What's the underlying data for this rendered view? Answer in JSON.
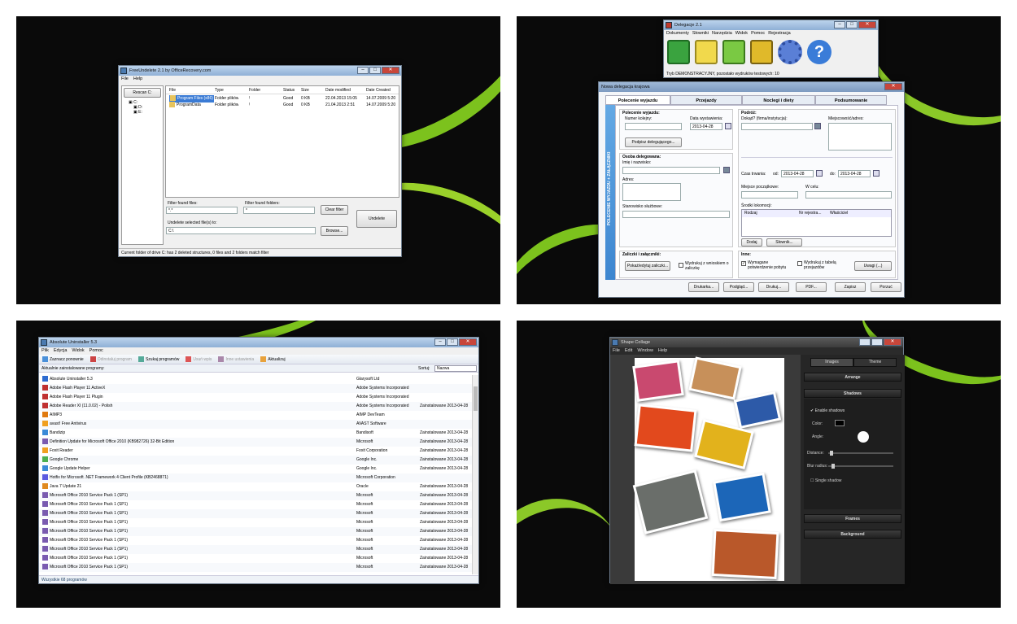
{
  "freeundelete": {
    "title": "FreeUndelete 2.1 by OfficeRecovery.com",
    "menu": [
      "File",
      "Help"
    ],
    "rescan_label": "Rescan C:",
    "drives": [
      "C:",
      "D:",
      "E:"
    ],
    "columns": [
      "File",
      "Type",
      "Folder",
      "Status",
      "Size",
      "Date modified",
      "Date Created"
    ],
    "rows": [
      [
        "Program Files (x86)",
        "Folder plików",
        "\\",
        "Good",
        "0 KB",
        "22.04.2013 15:05",
        "14.07.2009 5:20"
      ],
      [
        "ProgramData",
        "Folder plików",
        "\\",
        "Good",
        "0 KB",
        "21.04.2013 2:51",
        "14.07.2009 5:20"
      ]
    ],
    "filter_files_label": "Filter found files:",
    "filter_files_value": "*.*",
    "filter_folders_label": "Filter found folders:",
    "filter_folders_value": "*",
    "clear_filter_label": "Clear filter",
    "undelete_to_label": "Undelete selected file(s) to:",
    "undelete_to_value": "C:\\",
    "browse_label": "Browse...",
    "undelete_label": "Undelete",
    "status": "Current folder of drive C: has 2 deleted structures, 0 files and 2 folders match filter"
  },
  "delegacje": {
    "small_title": "Delegacje 2.1",
    "small_menu": [
      "Dokumenty",
      "Słowniki",
      "Narzędzia",
      "Widok",
      "Pomoc",
      "Rejestracja"
    ],
    "small_status": "Tryb DEMONSTRACYJNY, pozostało wydruków testowych: 10",
    "dialog_title": "Nowa delegacja krajowa",
    "tabs": [
      "Polecenie wyjazdu",
      "Przejazdy",
      "Noclegi i diety",
      "Podsumowanie"
    ],
    "side_label": "POLECENIE WYJAZDU + ZAŁĄCZNIKI",
    "polecenie_heading": "Polecenie wyjazdu:",
    "numer_label": "Numer kolejny:",
    "data_wyst_label": "Data wystawienia:",
    "data_wyst_value": "2013-04-28",
    "podpis_label": "Podpisz delegującego...",
    "osoba_heading": "Osoba delegowana:",
    "imie_label": "Imię i nazwisko:",
    "adres_label": "Adres:",
    "stanowisko_label": "Stanowisko służbowe:",
    "podroz_heading": "Podróż:",
    "dokad_label": "Dokąd? (firma/instytucja):",
    "miejscowosc_label": "Miejscowość/adres:",
    "czas_label": "Czas trwania:",
    "od_label": "od:",
    "od_value": "2013-04-28",
    "do_label": "do:",
    "do_value": "2013-04-28",
    "miejsce_label": "Miejsce początkowe:",
    "wcelu_label": "W celu:",
    "srodki_label": "Środki lokomocji:",
    "srodki_cols": [
      "Rodzaj",
      "Nr rejestra...",
      "Właściciel"
    ],
    "dodaj_label": "Dodaj",
    "slownik_label": "Słownik...",
    "zaliczki_heading": "Zaliczki i załączniki:",
    "pokaz_label": "Pokaż/edytuj zaliczki...",
    "wydruk_zal_label": "Wydrukuj z wnioskiem o zaliczkę",
    "inne_heading": "Inne:",
    "wymagane_label": "Wymagane potwierdzenie pobytu",
    "wydruk_tab_label": "Wydrukuj z tabelą przejazdów",
    "uwagi_label": "Uwagi (...)",
    "bottom_buttons": [
      "Drukarka...",
      "Podgląd...",
      "Drukuj...",
      "PDF...",
      "Zapisz",
      "Porzuć"
    ]
  },
  "absolute": {
    "title": "Absolute Uninstaller 5.3",
    "menu": [
      "Plik",
      "Edycja",
      "Widok",
      "Pomoc"
    ],
    "toolbar": [
      "Zaznacz ponownie",
      "Odinstaluj program",
      "Szukaj programów",
      "Usuń wpis",
      "Inne ustawienia",
      "Aktualizuj"
    ],
    "section_label": "Aktualnie zainstalowane programy:",
    "sort_label": "Sortuj:",
    "sort_value": "Nazwa",
    "programs": [
      [
        "Absolute Uninstaller 5.3",
        "Glarysoft Ltd",
        ""
      ],
      [
        "Adobe Flash Player 11 ActiveX",
        "Adobe Systems Incorporated",
        ""
      ],
      [
        "Adobe Flash Player 11 Plugin",
        "Adobe Systems Incorporated",
        ""
      ],
      [
        "Adobe Reader XI (11.0.02) - Polish",
        "Adobe Systems Incorporated",
        "Zainstalowane 2013-04-28"
      ],
      [
        "AIMP3",
        "AIMP DevTeam",
        ""
      ],
      [
        "avast! Free Antivirus",
        "AVAST Software",
        ""
      ],
      [
        "Bandizip",
        "Bandisoft",
        "Zainstalowane 2013-04-28"
      ],
      [
        "Definition Update for Microsoft Office 2010 (KB982726) 32-Bit Edition",
        "Microsoft",
        "Zainstalowane 2013-04-28"
      ],
      [
        "Foxit Reader",
        "Foxit Corporation",
        "Zainstalowane 2013-04-28"
      ],
      [
        "Google Chrome",
        "Google Inc.",
        "Zainstalowane 2013-04-28"
      ],
      [
        "Google Update Helper",
        "Google Inc.",
        "Zainstalowane 2013-04-28"
      ],
      [
        "Hotfix for Microsoft .NET Framework 4 Client Profile (KB2468871)",
        "Microsoft Corporation",
        ""
      ],
      [
        "Java 7 Update 21",
        "Oracle",
        "Zainstalowane 2013-04-28"
      ],
      [
        "Microsoft Office 2010 Service Pack 1 (SP1)",
        "Microsoft",
        "Zainstalowane 2013-04-28"
      ],
      [
        "Microsoft Office 2010 Service Pack 1 (SP1)",
        "Microsoft",
        "Zainstalowane 2013-04-28"
      ],
      [
        "Microsoft Office 2010 Service Pack 1 (SP1)",
        "Microsoft",
        "Zainstalowane 2013-04-28"
      ],
      [
        "Microsoft Office 2010 Service Pack 1 (SP1)",
        "Microsoft",
        "Zainstalowane 2013-04-28"
      ],
      [
        "Microsoft Office 2010 Service Pack 1 (SP1)",
        "Microsoft",
        "Zainstalowane 2013-04-28"
      ],
      [
        "Microsoft Office 2010 Service Pack 1 (SP1)",
        "Microsoft",
        "Zainstalowane 2013-04-28"
      ],
      [
        "Microsoft Office 2010 Service Pack 1 (SP1)",
        "Microsoft",
        "Zainstalowane 2013-04-28"
      ],
      [
        "Microsoft Office 2010 Service Pack 1 (SP1)",
        "Microsoft",
        "Zainstalowane 2013-04-28"
      ],
      [
        "Microsoft Office 2010 Service Pack 1 (SP1)",
        "Microsoft",
        "Zainstalowane 2013-04-28"
      ]
    ],
    "status": "Wszystkie 68 programów"
  },
  "shape": {
    "title": "Shape Collage",
    "menu": [
      "File",
      "Edit",
      "Window",
      "Help"
    ],
    "tabs": [
      "Images",
      "Theme"
    ],
    "arrange_label": "Arrange",
    "shadows_label": "Shadows",
    "enable_label": "Enable shadows",
    "color_label": "Color:",
    "angle_label": "Angle:",
    "distance_label": "Distance:",
    "blur_label": "Blur radius:",
    "single_label": "Single shadow",
    "frames_label": "Frames",
    "background_label": "Background",
    "photo_colors": [
      "#c9496f",
      "#c7905a",
      "#2d5aa8",
      "#e2491d",
      "#e2b21c",
      "#6a6e6a",
      "#1c66b8",
      "#b9582a"
    ]
  }
}
